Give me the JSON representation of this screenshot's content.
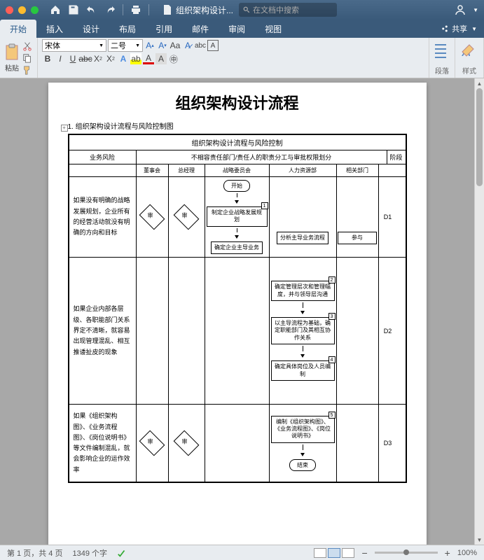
{
  "titlebar": {
    "doc_name": "组织架构设计...",
    "search_placeholder": "在文档中搜索"
  },
  "tabs": {
    "items": [
      "开始",
      "插入",
      "设计",
      "布局",
      "引用",
      "邮件",
      "审阅",
      "视图"
    ],
    "active": 0,
    "share": "共享"
  },
  "ribbon": {
    "paste": "粘贴",
    "font_name": "宋体",
    "font_size": "二号",
    "group_para": "段落",
    "group_style": "样式"
  },
  "document": {
    "title": "组织架构设计流程",
    "section": "1. 组织架构设计流程与风险控制图",
    "table": {
      "header_main": "组织架构设计流程与风险控制",
      "header_mid": "不相容责任部门/责任人的职责分工与审批权限划分",
      "col_risk": "业务风险",
      "col_board": "董事会",
      "col_gm": "总经理",
      "col_strat": "战略委员会",
      "col_hr": "人力资源部",
      "col_dept": "相关部门",
      "col_phase": "阶段",
      "rows": [
        {
          "risk": "如果没有明确的战略发展规划，企业所有的经营活动就没有明确的方向和目标",
          "phase": "D1",
          "start": "开始",
          "strat1": "制定企业战略发展规划",
          "strat2": "确定企业主导业务",
          "hr1": "分析主导业务流程",
          "dept1": "参与"
        },
        {
          "risk": "如果企业内部各层级、各职能部门关系界定不清晰，就容易出现管理混乱、相互推诿扯皮的现象",
          "phase": "D2",
          "hr2": "确定管理层次和管理幅度，并与领导层沟通",
          "hr3": "以主导流程为基础，确定职能部门及其相互协作关系",
          "hr4": "确定具体岗位及人员编制"
        },
        {
          "risk": "如果《组织架构图》、《业务流程图》、《岗位说明书》等文件编制混乱，就会影响企业的运作效率",
          "phase": "D3",
          "hr5": "编制《组织架构图》、《业务流程图》、《岗位说明书》",
          "end": "结束"
        }
      ],
      "review": "审"
    }
  },
  "statusbar": {
    "page": "第 1 页，共 4 页",
    "words": "1349 个字",
    "zoom": "100%"
  }
}
